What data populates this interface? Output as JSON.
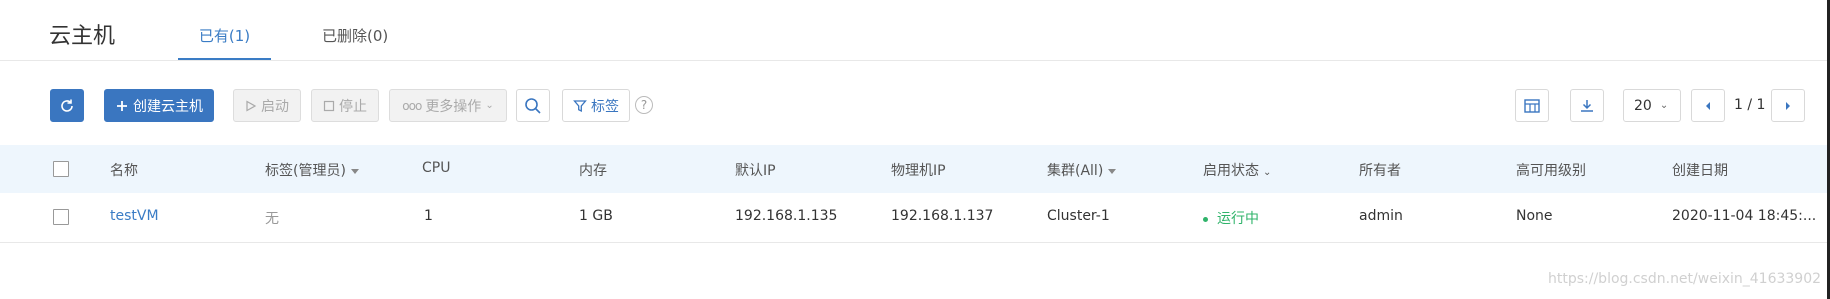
{
  "header": {
    "title": "云主机",
    "tabs": [
      {
        "label": "已有(1)",
        "active": true
      },
      {
        "label": "已删除(0)",
        "active": false
      }
    ]
  },
  "toolbar": {
    "refresh_icon": "refresh-icon",
    "create_label": "创建云主机",
    "start_label": "启动",
    "stop_label": "停止",
    "more_label": "更多操作",
    "tag_label": "标签",
    "help_glyph": "?"
  },
  "pagination": {
    "page_size": "20",
    "page_text": "1 / 1"
  },
  "table": {
    "columns": [
      "名称",
      "标签(管理员)",
      "CPU",
      "内存",
      "默认IP",
      "物理机IP",
      "集群(All)",
      "启用状态",
      "所有者",
      "高可用级别",
      "创建日期"
    ],
    "rows": [
      {
        "name": "testVM",
        "tag": "无",
        "cpu": "1",
        "memory": "1 GB",
        "default_ip": "192.168.1.135",
        "host_ip": "192.168.1.137",
        "cluster": "Cluster-1",
        "status": "运行中",
        "owner": "admin",
        "ha_level": "None",
        "created": "2020-11-04 18:45:..."
      }
    ]
  },
  "watermark": "https://blog.csdn.net/weixin_41633902",
  "colors": {
    "accent": "#3a76c0",
    "header_bg": "#eef6fd",
    "status_running": "#2fb36a"
  }
}
